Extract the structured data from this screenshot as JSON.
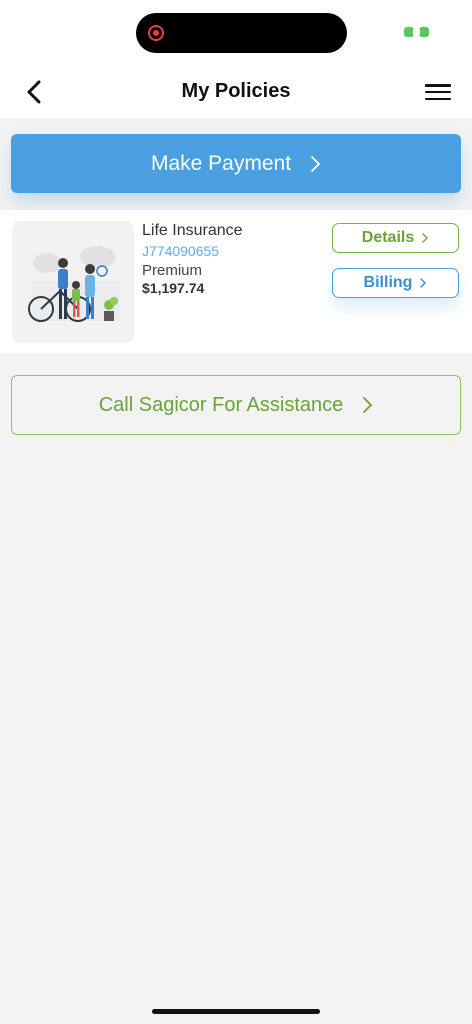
{
  "header": {
    "title": "My Policies",
    "back_icon": "chevron-left-icon",
    "menu_icon": "hamburger-menu-icon"
  },
  "actions": {
    "make_payment_label": "Make Payment",
    "call_assistance_label": "Call Sagicor For Assistance"
  },
  "policy": {
    "name": "Life Insurance",
    "number": "J774090655",
    "premium_label": "Premium",
    "premium_value": "$1,197.74",
    "details_label": "Details",
    "billing_label": "Billing",
    "image": "family-illustration"
  },
  "colors": {
    "primary_blue": "#4a9fe0",
    "accent_green": "#79b33f",
    "background": "#f3f3f3"
  }
}
